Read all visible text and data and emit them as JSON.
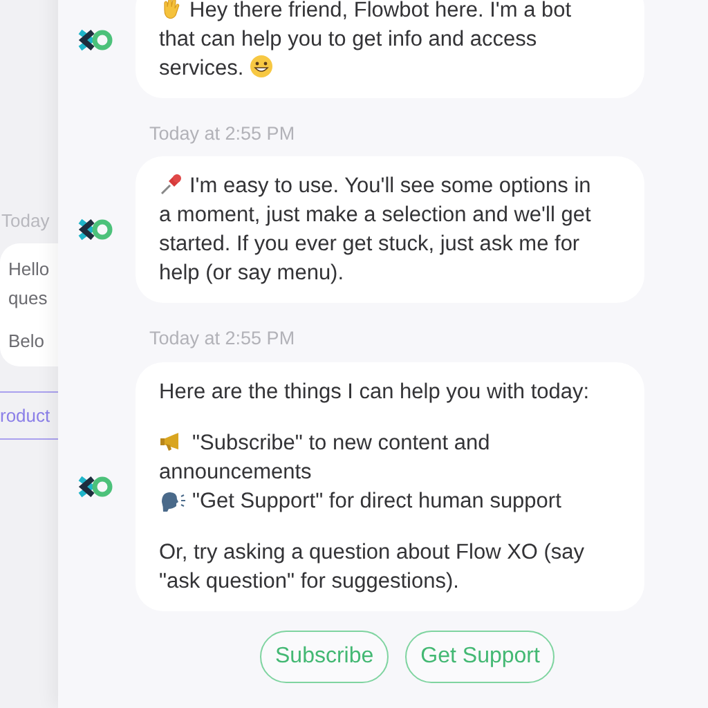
{
  "background_card": {
    "timestamp": "Today",
    "lines": [
      "Hello",
      "ques",
      "Belo"
    ],
    "button": "roduct"
  },
  "messages": [
    {
      "paragraphs": [
        [
          "Hey there friend, Flowbot here. I'm a bot that can help you to get info and access services."
        ]
      ]
    },
    {
      "timestamp": "Today at 2:55 PM",
      "paragraphs": [
        [
          "I'm easy to use. You'll see some options in a moment, just make a selection and we'll get started. If you ever get stuck, just ask me for help (or say menu)."
        ]
      ]
    },
    {
      "timestamp": "Today at 2:55 PM",
      "paragraphs": [
        [
          "Here are the things I can help you with today:"
        ],
        [
          "\"Subscribe\" to new content and announcements",
          "\"Get Support\" for direct human support"
        ],
        [
          "Or, try asking a question about Flow XO (say \"ask question\" for suggestions)."
        ]
      ]
    }
  ],
  "quick_replies": [
    "Subscribe",
    "Get Support"
  ]
}
